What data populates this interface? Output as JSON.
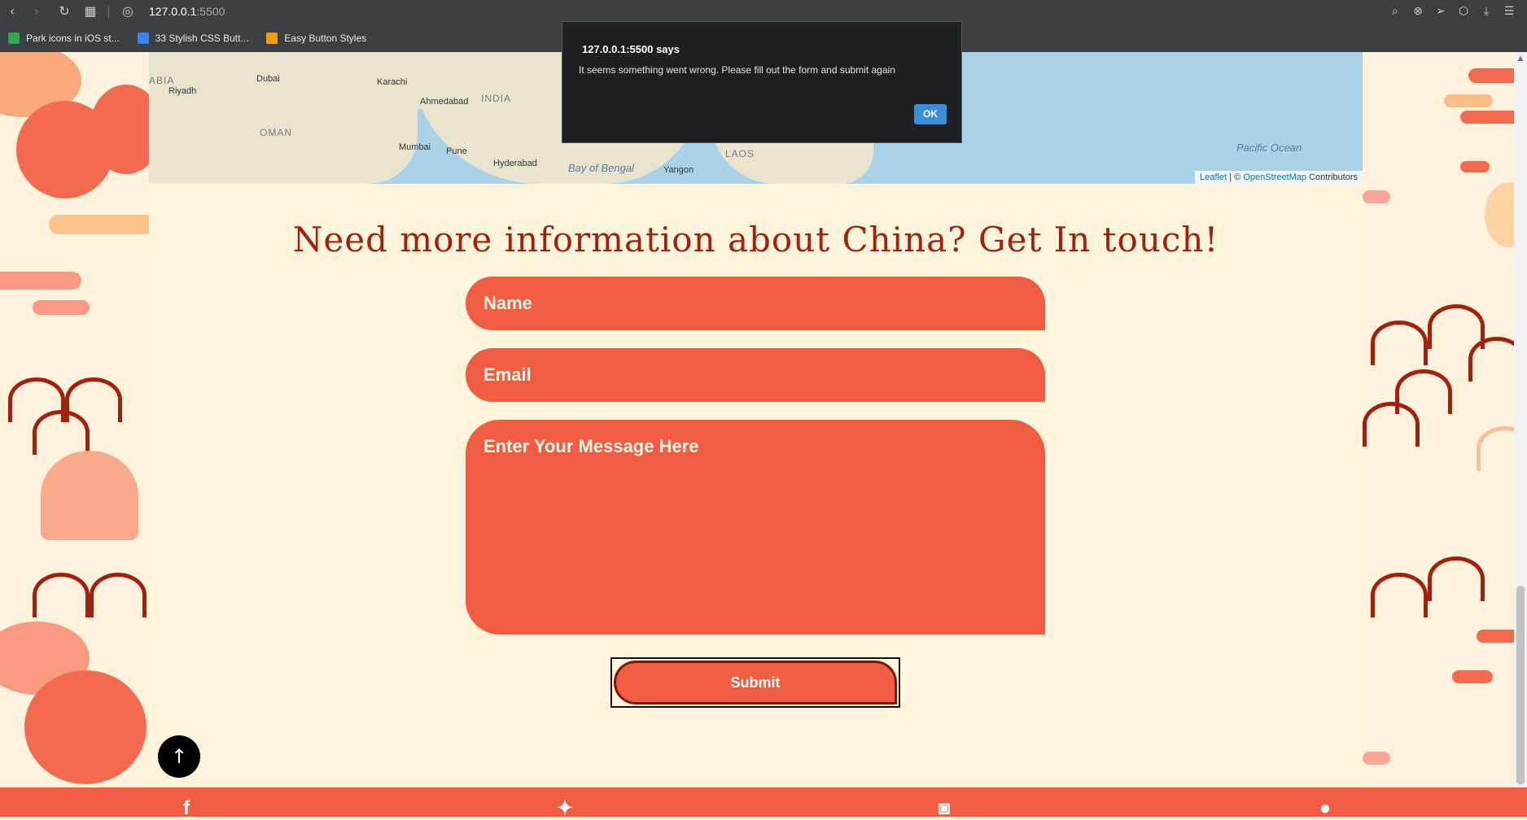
{
  "browser": {
    "url_host": "127.0.0.1",
    "url_port": ":5500",
    "bookmarks": [
      {
        "label": "Park icons in iOS st...",
        "color": "#2eaa4a"
      },
      {
        "label": "33 Stylish CSS Butt...",
        "color": "#3b82f6"
      },
      {
        "label": "Easy Button Styles",
        "color": "#f59e0b"
      }
    ]
  },
  "alert": {
    "title": "127.0.0.1:5500 says",
    "message": "It seems something went wrong. Please fill out the form and submit again",
    "ok_label": "OK"
  },
  "map": {
    "labels": {
      "abia": "ABIA",
      "riyadh": "Riyadh",
      "dubai": "Dubai",
      "karachi": "Karachi",
      "ahmedabad": "Ahmedabad",
      "india": "INDIA",
      "oman": "OMAN",
      "mumbai": "Mumbai",
      "pune": "Pune",
      "hyderabad": "Hyderabad",
      "bay_of_bengal": "Bay of Bengal",
      "laos": "LAOS",
      "yangon": "Yangon",
      "pacific_ocean": "Pacific Ocean"
    },
    "attribution": {
      "leaflet": "Leaflet",
      "sep": "| ©",
      "osm": "OpenStreetMap",
      "contributors": "Contributors"
    }
  },
  "contact": {
    "heading": "Need more information about China? Get In touch!",
    "name_placeholder": "Name",
    "email_placeholder": "Email",
    "message_placeholder": "Enter Your Message Here",
    "submit_label": "Submit"
  },
  "colors": {
    "accent": "#f15c43",
    "heading": "#a1210f",
    "background": "#fff4dc"
  },
  "icons": {
    "to_top": "arrow-up-icon",
    "social": [
      "facebook-icon",
      "twitter-icon",
      "instagram-icon",
      "github-icon"
    ]
  }
}
